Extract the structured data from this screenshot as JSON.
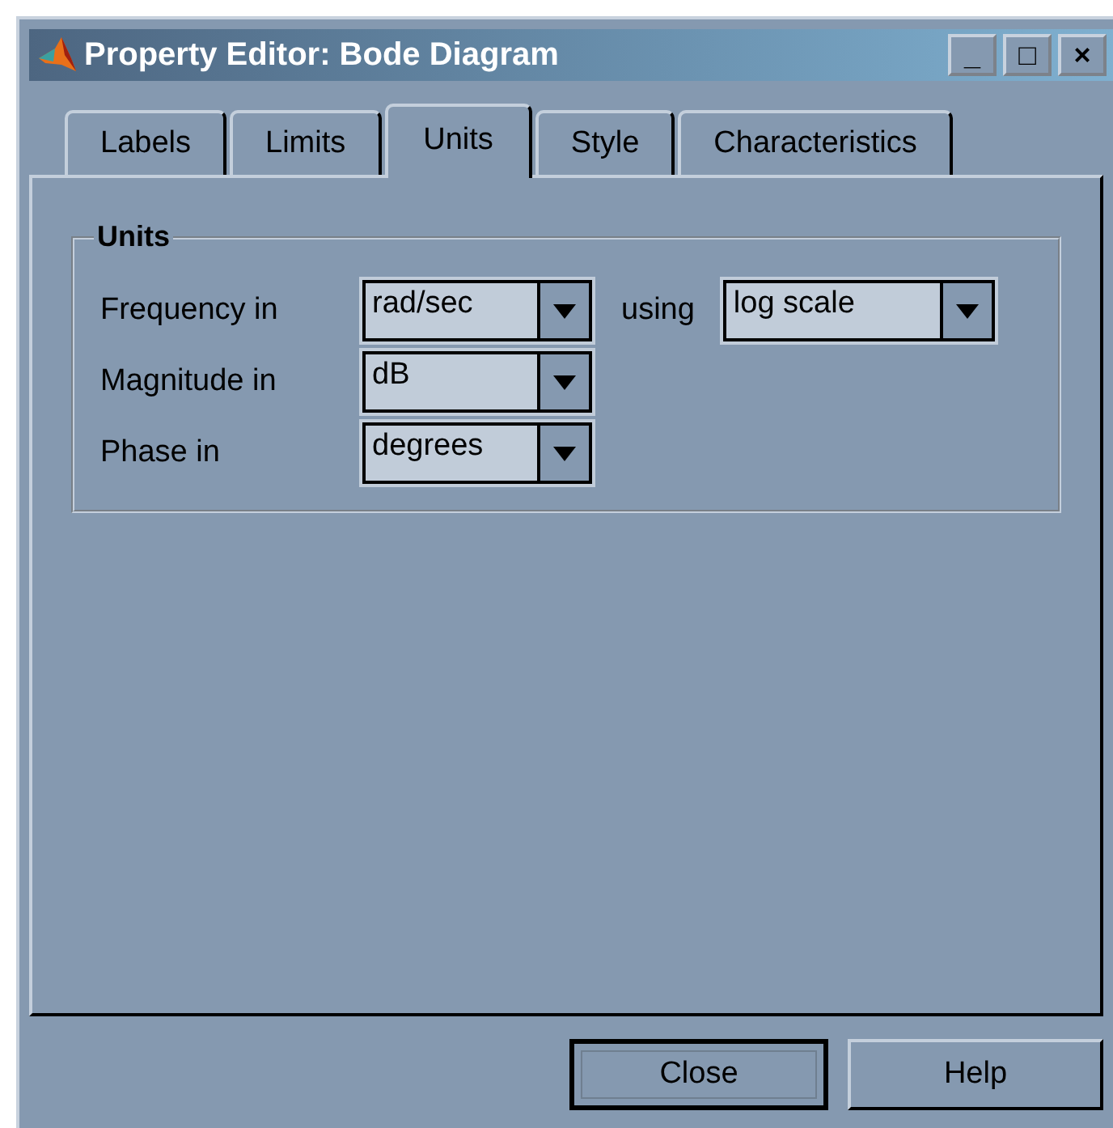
{
  "window": {
    "title": "Property Editor: Bode Diagram",
    "controls": [
      "_",
      "□",
      "×"
    ]
  },
  "tabs": [
    {
      "label": "Labels",
      "selected": false
    },
    {
      "label": "Limits",
      "selected": false
    },
    {
      "label": "Units",
      "selected": true
    },
    {
      "label": "Style",
      "selected": false
    },
    {
      "label": "Characteristics",
      "selected": false
    }
  ],
  "group": {
    "title": "Units",
    "rows": [
      {
        "label": "Frequency in",
        "value": "rad/sec",
        "extra_label": "using",
        "extra_value": "log scale"
      },
      {
        "label": "Magnitude in",
        "value": "dB"
      },
      {
        "label": "Phase in",
        "value": "degrees"
      }
    ]
  },
  "buttons": [
    {
      "label": "Close",
      "default": true
    },
    {
      "label": "Help",
      "default": false
    }
  ]
}
